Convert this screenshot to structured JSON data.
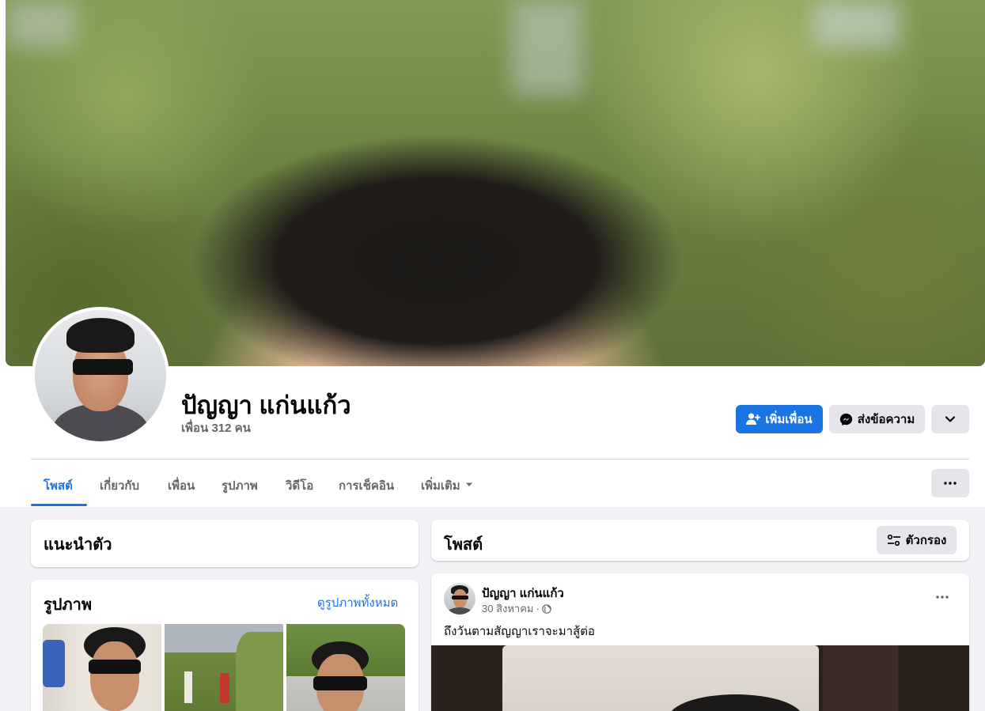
{
  "profile": {
    "name": "ปัญญา แก่นแก้ว",
    "friends_text": "เพื่อน 312 คน"
  },
  "actions": {
    "add_friend": "เพิ่มเพื่อน",
    "message": "ส่งข้อความ"
  },
  "tabs": [
    {
      "label": "โพสต์",
      "active": true
    },
    {
      "label": "เกี่ยวกับ",
      "active": false
    },
    {
      "label": "เพื่อน",
      "active": false
    },
    {
      "label": "รูปภาพ",
      "active": false
    },
    {
      "label": "วิดีโอ",
      "active": false
    },
    {
      "label": "การเช็คอิน",
      "active": false
    },
    {
      "label": "เพิ่มเติม",
      "active": false
    }
  ],
  "intro": {
    "title": "แนะนำตัว"
  },
  "photos": {
    "title": "รูปภาพ",
    "see_all": "ดูรูปภาพทั้งหมด"
  },
  "posts_header": {
    "title": "โพสต์",
    "filter": "ตัวกรอง"
  },
  "post": {
    "author": "ปัญญา แก่นแก้ว",
    "date": "30 สิงหาคม",
    "separator": "·",
    "text": "ถึงวันตามสัญญาเราจะมาสู้ต่อ",
    "privacy_icon": "globe-icon"
  },
  "colors": {
    "accent": "#1b74e4",
    "background": "#f0f2f5",
    "secondary_button": "#e4e6eb",
    "muted_text": "#65676b"
  }
}
